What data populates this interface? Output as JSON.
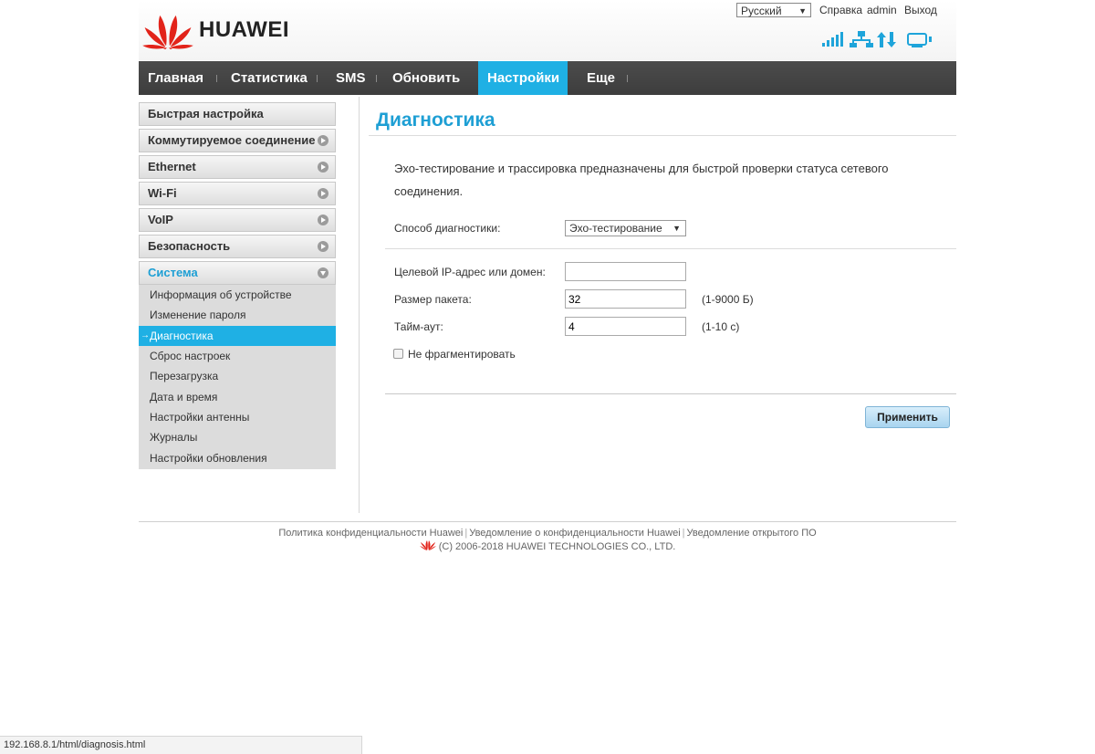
{
  "header": {
    "brand": "HUAWEI",
    "language": "Русский",
    "links": {
      "help": "Справка",
      "user": "admin",
      "logout": "Выход"
    },
    "status_icons": [
      "signal-strength-icon",
      "network-icon",
      "data-transfer-icon",
      "wifi-device-icon"
    ]
  },
  "nav": {
    "items": [
      {
        "label": "Главная"
      },
      {
        "label": "Статистика"
      },
      {
        "label": "SMS"
      },
      {
        "label": "Обновить"
      },
      {
        "label": "Настройки",
        "active": true
      },
      {
        "label": "Еще"
      }
    ]
  },
  "sidebar": {
    "sections": [
      {
        "label": "Быстрая настройка"
      },
      {
        "label": "Коммутируемое соединение"
      },
      {
        "label": "Ethernet"
      },
      {
        "label": "Wi-Fi"
      },
      {
        "label": "VoIP"
      },
      {
        "label": "Безопасность"
      },
      {
        "label": "Система",
        "expanded": true
      }
    ],
    "subitems": [
      {
        "label": "Информация об устройстве"
      },
      {
        "label": "Изменение пароля"
      },
      {
        "label": "Диагностика",
        "selected": true
      },
      {
        "label": "Сброс настроек"
      },
      {
        "label": "Перезагрузка"
      },
      {
        "label": "Дата и время"
      },
      {
        "label": "Настройки антенны"
      },
      {
        "label": "Журналы"
      },
      {
        "label": "Настройки обновления"
      }
    ]
  },
  "main": {
    "title": "Диагностика",
    "description": "Эхо-тестирование и трассировка предназначены для быстрой проверки статуса сетевого соединения.",
    "method_label": "Способ диагностики:",
    "method_value": "Эхо-тестирование",
    "target_label": "Целевой IP-адрес или домен:",
    "target_value": "",
    "packet_label": "Размер пакета:",
    "packet_value": "32",
    "packet_hint": "(1-9000 Б)",
    "timeout_label": "Тайм-аут:",
    "timeout_value": "4",
    "timeout_hint": "(1-10 с)",
    "nofrag_label": "Не фрагментировать",
    "nofrag_checked": false,
    "apply_label": "Применить"
  },
  "footer": {
    "links": [
      "Политика конфиденциальности Huawei",
      "Уведомление о конфиденциальности Huawei",
      "Уведомление открытого ПО"
    ],
    "copyright": "(C) 2006-2018 HUAWEI TECHNOLOGIES CO., LTD."
  },
  "browser": {
    "status_url": "192.168.8.1/html/diagnosis.html"
  },
  "colors": {
    "accent": "#1fb0e4",
    "nav_bg": "#444444",
    "brand_red": "#e2231a"
  }
}
